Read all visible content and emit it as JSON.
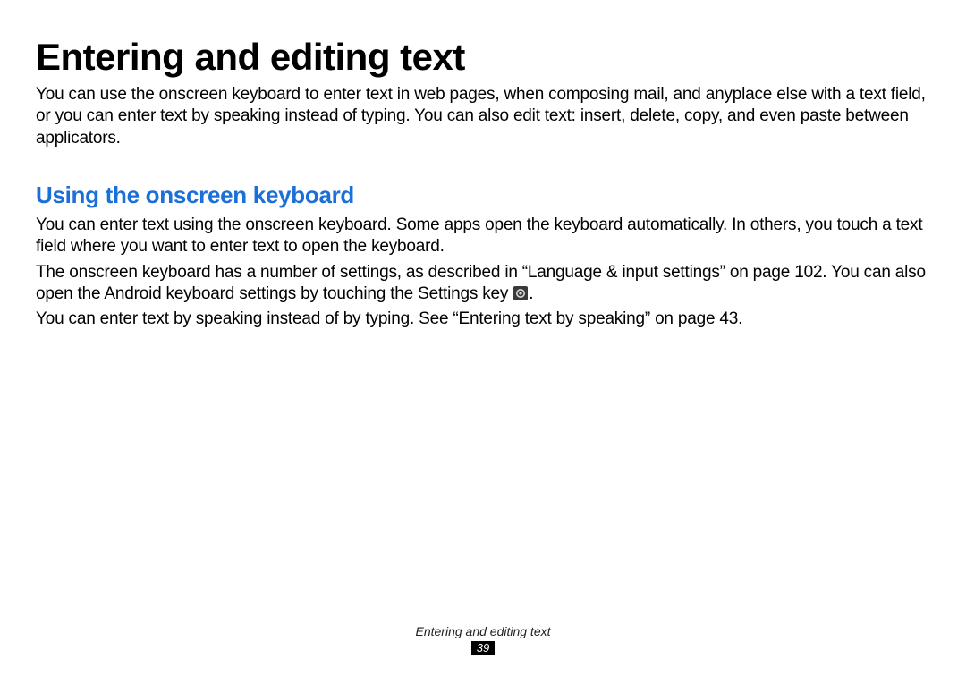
{
  "title": "Entering and editing text",
  "intro": "You can use the onscreen keyboard to enter text in web pages, when composing mail, and anyplace else with a text field, or you can enter text by speaking instead of typing. You can also edit text: insert, delete, copy, and even paste between applicators.",
  "section": {
    "heading": "Using the onscreen keyboard",
    "p1": "You can enter text using the onscreen keyboard. Some apps open the keyboard automatically. In others, you touch a text field where you want to enter text to open the keyboard.",
    "p2a": "The onscreen keyboard has a number of settings, as described in “Language & input settings” on page 102. You can also open the Android keyboard settings by touching the Settings key ",
    "p2b": ".",
    "p3": "You can enter text by speaking instead of by typing. See “Entering text by speaking” on page 43."
  },
  "footer": {
    "chapter": "Entering and editing text",
    "page": "39"
  }
}
